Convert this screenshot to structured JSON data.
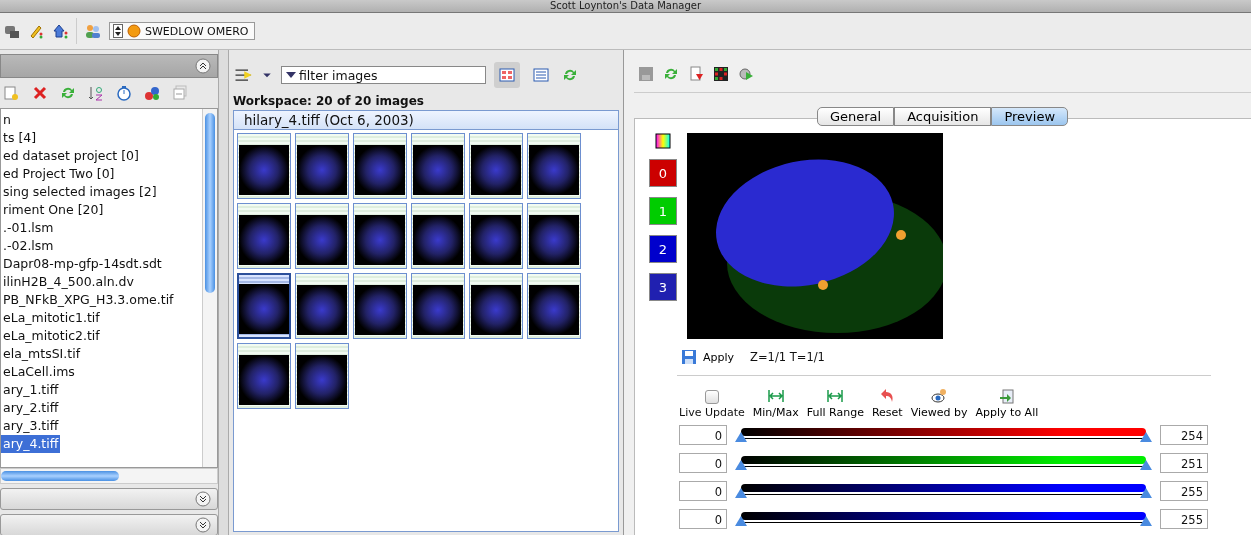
{
  "window": {
    "title": "Scott Loynton's Data Manager"
  },
  "toolbar": {
    "server": "SWEDLOW OMERO"
  },
  "browser": {
    "tree": [
      {
        "label": "n",
        "selected": false
      },
      {
        "label": "ts [4]",
        "selected": false
      },
      {
        "label": "ed dataset project [0]",
        "selected": false
      },
      {
        "label": "ed Project Two [0]",
        "selected": false
      },
      {
        "label": "sing selected images [2]",
        "selected": false
      },
      {
        "label": "riment One [20]",
        "selected": false
      },
      {
        "label": ".-01.lsm",
        "selected": false
      },
      {
        "label": ".-02.lsm",
        "selected": false
      },
      {
        "label": "Dapr08-mp-gfp-14sdt.sdt",
        "selected": false
      },
      {
        "label": "ilinH2B_4_500.aln.dv",
        "selected": false
      },
      {
        "label": "PB_NFkB_XPG_H3.3.ome.tif",
        "selected": false
      },
      {
        "label": "eLa_mitotic1.tif",
        "selected": false
      },
      {
        "label": "eLa_mitotic2.tif",
        "selected": false
      },
      {
        "label": "ela_mtsSI.tif",
        "selected": false
      },
      {
        "label": "eLaCell.ims",
        "selected": false
      },
      {
        "label": "ary_1.tiff",
        "selected": false
      },
      {
        "label": "ary_2.tiff",
        "selected": false
      },
      {
        "label": "ary_3.tiff",
        "selected": false
      },
      {
        "label": "ary_4.tiff",
        "selected": true
      }
    ]
  },
  "workspace": {
    "filter": {
      "value": "filter  images"
    },
    "summary": "Workspace: 20 of 20 images",
    "group": "hilary_4.tiff (Oct 6, 2003)",
    "thumbnails": [
      {
        "selected": false
      },
      {
        "selected": false
      },
      {
        "selected": false
      },
      {
        "selected": false
      },
      {
        "selected": false
      },
      {
        "selected": false
      },
      {
        "selected": false
      },
      {
        "selected": false
      },
      {
        "selected": false
      },
      {
        "selected": false
      },
      {
        "selected": false
      },
      {
        "selected": false
      },
      {
        "selected": true
      },
      {
        "selected": false
      },
      {
        "selected": false
      },
      {
        "selected": false
      },
      {
        "selected": false
      },
      {
        "selected": false
      },
      {
        "selected": false
      },
      {
        "selected": false
      }
    ]
  },
  "viewer": {
    "tabs": [
      {
        "label": "General",
        "selected": false
      },
      {
        "label": "Acquisition",
        "selected": false
      },
      {
        "label": "Preview",
        "selected": true
      }
    ],
    "channels": [
      {
        "label": "0",
        "color": "#cc0000"
      },
      {
        "label": "1",
        "color": "#00cc00"
      },
      {
        "label": "2",
        "color": "#0000cc"
      },
      {
        "label": "3",
        "color": "#2020b0"
      }
    ],
    "apply": "Apply",
    "position": "Z=1/1 T=1/1",
    "controls": [
      {
        "kind": "checkbox",
        "label": "Live Update",
        "checked": false
      },
      {
        "kind": "minmax",
        "label": "Min/Max"
      },
      {
        "kind": "fullrange",
        "label": "Full Range"
      },
      {
        "kind": "reset",
        "label": "Reset"
      },
      {
        "kind": "viewed",
        "label": "Viewed by"
      },
      {
        "kind": "applyall",
        "label": "Apply to All"
      }
    ],
    "sliders": [
      {
        "min": "0",
        "max": "254",
        "color": "#ff0000",
        "level": 1
      },
      {
        "min": "0",
        "max": "251",
        "color": "#00ee00",
        "level": 1
      },
      {
        "min": "0",
        "max": "255",
        "color": "#0000ff",
        "level": 1
      },
      {
        "min": "0",
        "max": "255",
        "color": "#0000ff",
        "level": 1
      }
    ]
  }
}
